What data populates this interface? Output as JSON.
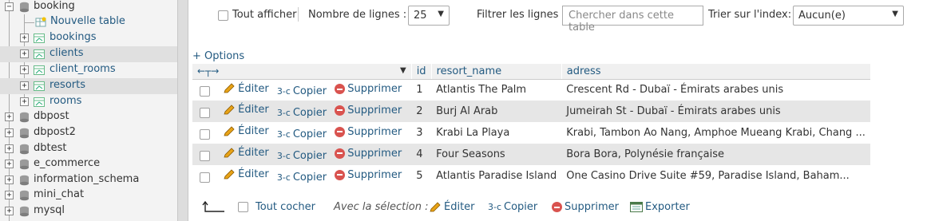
{
  "navigation": {
    "current_db": "booking",
    "new_table": "Nouvelle table",
    "tables": [
      "bookings",
      "clients",
      "client_rooms",
      "resorts",
      "rooms"
    ],
    "other_dbs": [
      "dbpost",
      "dbpost2",
      "dbtest",
      "e_commerce",
      "information_schema",
      "mini_chat",
      "mysql"
    ],
    "expand_symbol": "+",
    "collapse_symbol": "−"
  },
  "toolbar": {
    "show_all": "Tout afficher",
    "rows_label": "Nombre de lignes :",
    "rows_value": "25",
    "filter_label": "Filtrer les lignes :",
    "filter_placeholder": "Chercher dans cette table",
    "sort_label": "Trier sur l'index:",
    "sort_value": "Aucun(e)"
  },
  "options_link": "+ Options",
  "columns": [
    "id",
    "resort_name",
    "adress"
  ],
  "actions": {
    "edit": "Éditer",
    "copy": "Copier",
    "delete": "Supprimer"
  },
  "rows": [
    {
      "id": "1",
      "resort_name": "Atlantis The Palm",
      "adress": "Crescent Rd - Dubaï - Émirats arabes unis"
    },
    {
      "id": "2",
      "resort_name": "Burj Al Arab",
      "adress": "Jumeirah St - Dubaï - Émirats arabes unis"
    },
    {
      "id": "3",
      "resort_name": "Krabi La Playa",
      "adress": "Krabi, Tambon Ao Nang, Amphoe Mueang Krabi, Chang ..."
    },
    {
      "id": "4",
      "resort_name": "Four Seasons",
      "adress": "Bora Bora, Polynésie française"
    },
    {
      "id": "5",
      "resort_name": "Atlantis Paradise Island",
      "adress": "One Casino Drive Suite #59, Paradise Island, Baham..."
    }
  ],
  "footer": {
    "check_all": "Tout cocher",
    "with_selection": "Avec la sélection :",
    "edit": "Éditer",
    "copy": "Copier",
    "delete": "Supprimer",
    "export": "Exporter"
  },
  "colors": {
    "link": "#235a81",
    "delete_icon": "#d9534f",
    "pencil": "#e8a317",
    "highlight": "#e0e0e0"
  }
}
